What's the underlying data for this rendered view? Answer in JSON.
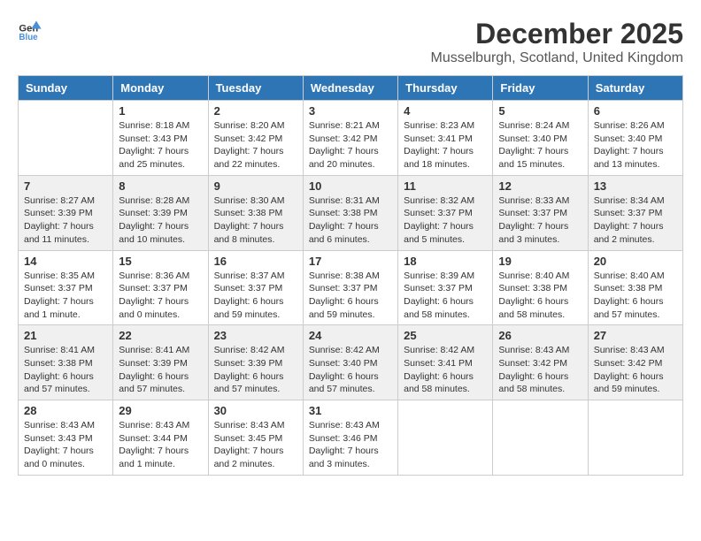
{
  "header": {
    "logo_line1": "General",
    "logo_line2": "Blue",
    "main_title": "December 2025",
    "subtitle": "Musselburgh, Scotland, United Kingdom"
  },
  "weekdays": [
    "Sunday",
    "Monday",
    "Tuesday",
    "Wednesday",
    "Thursday",
    "Friday",
    "Saturday"
  ],
  "weeks": [
    [
      {
        "day": "",
        "sunrise": "",
        "sunset": "",
        "daylight": ""
      },
      {
        "day": "1",
        "sunrise": "Sunrise: 8:18 AM",
        "sunset": "Sunset: 3:43 PM",
        "daylight": "Daylight: 7 hours and 25 minutes."
      },
      {
        "day": "2",
        "sunrise": "Sunrise: 8:20 AM",
        "sunset": "Sunset: 3:42 PM",
        "daylight": "Daylight: 7 hours and 22 minutes."
      },
      {
        "day": "3",
        "sunrise": "Sunrise: 8:21 AM",
        "sunset": "Sunset: 3:42 PM",
        "daylight": "Daylight: 7 hours and 20 minutes."
      },
      {
        "day": "4",
        "sunrise": "Sunrise: 8:23 AM",
        "sunset": "Sunset: 3:41 PM",
        "daylight": "Daylight: 7 hours and 18 minutes."
      },
      {
        "day": "5",
        "sunrise": "Sunrise: 8:24 AM",
        "sunset": "Sunset: 3:40 PM",
        "daylight": "Daylight: 7 hours and 15 minutes."
      },
      {
        "day": "6",
        "sunrise": "Sunrise: 8:26 AM",
        "sunset": "Sunset: 3:40 PM",
        "daylight": "Daylight: 7 hours and 13 minutes."
      }
    ],
    [
      {
        "day": "7",
        "sunrise": "Sunrise: 8:27 AM",
        "sunset": "Sunset: 3:39 PM",
        "daylight": "Daylight: 7 hours and 11 minutes."
      },
      {
        "day": "8",
        "sunrise": "Sunrise: 8:28 AM",
        "sunset": "Sunset: 3:39 PM",
        "daylight": "Daylight: 7 hours and 10 minutes."
      },
      {
        "day": "9",
        "sunrise": "Sunrise: 8:30 AM",
        "sunset": "Sunset: 3:38 PM",
        "daylight": "Daylight: 7 hours and 8 minutes."
      },
      {
        "day": "10",
        "sunrise": "Sunrise: 8:31 AM",
        "sunset": "Sunset: 3:38 PM",
        "daylight": "Daylight: 7 hours and 6 minutes."
      },
      {
        "day": "11",
        "sunrise": "Sunrise: 8:32 AM",
        "sunset": "Sunset: 3:37 PM",
        "daylight": "Daylight: 7 hours and 5 minutes."
      },
      {
        "day": "12",
        "sunrise": "Sunrise: 8:33 AM",
        "sunset": "Sunset: 3:37 PM",
        "daylight": "Daylight: 7 hours and 3 minutes."
      },
      {
        "day": "13",
        "sunrise": "Sunrise: 8:34 AM",
        "sunset": "Sunset: 3:37 PM",
        "daylight": "Daylight: 7 hours and 2 minutes."
      }
    ],
    [
      {
        "day": "14",
        "sunrise": "Sunrise: 8:35 AM",
        "sunset": "Sunset: 3:37 PM",
        "daylight": "Daylight: 7 hours and 1 minute."
      },
      {
        "day": "15",
        "sunrise": "Sunrise: 8:36 AM",
        "sunset": "Sunset: 3:37 PM",
        "daylight": "Daylight: 7 hours and 0 minutes."
      },
      {
        "day": "16",
        "sunrise": "Sunrise: 8:37 AM",
        "sunset": "Sunset: 3:37 PM",
        "daylight": "Daylight: 6 hours and 59 minutes."
      },
      {
        "day": "17",
        "sunrise": "Sunrise: 8:38 AM",
        "sunset": "Sunset: 3:37 PM",
        "daylight": "Daylight: 6 hours and 59 minutes."
      },
      {
        "day": "18",
        "sunrise": "Sunrise: 8:39 AM",
        "sunset": "Sunset: 3:37 PM",
        "daylight": "Daylight: 6 hours and 58 minutes."
      },
      {
        "day": "19",
        "sunrise": "Sunrise: 8:40 AM",
        "sunset": "Sunset: 3:38 PM",
        "daylight": "Daylight: 6 hours and 58 minutes."
      },
      {
        "day": "20",
        "sunrise": "Sunrise: 8:40 AM",
        "sunset": "Sunset: 3:38 PM",
        "daylight": "Daylight: 6 hours and 57 minutes."
      }
    ],
    [
      {
        "day": "21",
        "sunrise": "Sunrise: 8:41 AM",
        "sunset": "Sunset: 3:38 PM",
        "daylight": "Daylight: 6 hours and 57 minutes."
      },
      {
        "day": "22",
        "sunrise": "Sunrise: 8:41 AM",
        "sunset": "Sunset: 3:39 PM",
        "daylight": "Daylight: 6 hours and 57 minutes."
      },
      {
        "day": "23",
        "sunrise": "Sunrise: 8:42 AM",
        "sunset": "Sunset: 3:39 PM",
        "daylight": "Daylight: 6 hours and 57 minutes."
      },
      {
        "day": "24",
        "sunrise": "Sunrise: 8:42 AM",
        "sunset": "Sunset: 3:40 PM",
        "daylight": "Daylight: 6 hours and 57 minutes."
      },
      {
        "day": "25",
        "sunrise": "Sunrise: 8:42 AM",
        "sunset": "Sunset: 3:41 PM",
        "daylight": "Daylight: 6 hours and 58 minutes."
      },
      {
        "day": "26",
        "sunrise": "Sunrise: 8:43 AM",
        "sunset": "Sunset: 3:42 PM",
        "daylight": "Daylight: 6 hours and 58 minutes."
      },
      {
        "day": "27",
        "sunrise": "Sunrise: 8:43 AM",
        "sunset": "Sunset: 3:42 PM",
        "daylight": "Daylight: 6 hours and 59 minutes."
      }
    ],
    [
      {
        "day": "28",
        "sunrise": "Sunrise: 8:43 AM",
        "sunset": "Sunset: 3:43 PM",
        "daylight": "Daylight: 7 hours and 0 minutes."
      },
      {
        "day": "29",
        "sunrise": "Sunrise: 8:43 AM",
        "sunset": "Sunset: 3:44 PM",
        "daylight": "Daylight: 7 hours and 1 minute."
      },
      {
        "day": "30",
        "sunrise": "Sunrise: 8:43 AM",
        "sunset": "Sunset: 3:45 PM",
        "daylight": "Daylight: 7 hours and 2 minutes."
      },
      {
        "day": "31",
        "sunrise": "Sunrise: 8:43 AM",
        "sunset": "Sunset: 3:46 PM",
        "daylight": "Daylight: 7 hours and 3 minutes."
      },
      {
        "day": "",
        "sunrise": "",
        "sunset": "",
        "daylight": ""
      },
      {
        "day": "",
        "sunrise": "",
        "sunset": "",
        "daylight": ""
      },
      {
        "day": "",
        "sunrise": "",
        "sunset": "",
        "daylight": ""
      }
    ]
  ]
}
